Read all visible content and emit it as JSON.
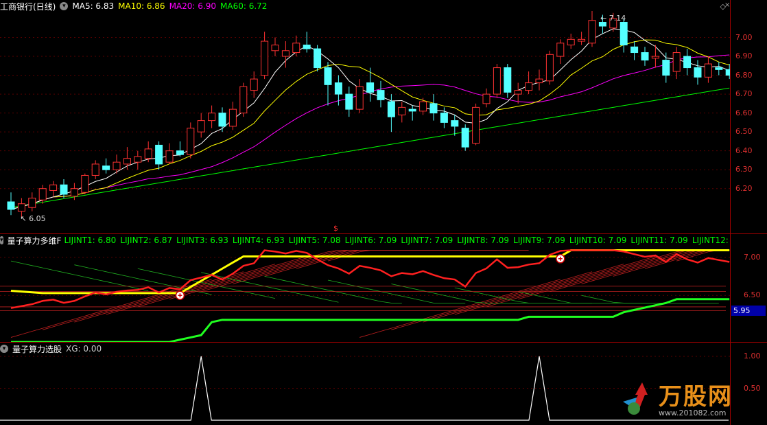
{
  "colors": {
    "ma5": "#ffffff",
    "ma10": "#ffff00",
    "ma20": "#ff00ff",
    "ma60": "#00ff00",
    "up": "#ff3232",
    "down": "#54ffff",
    "lijint": "#00ff00",
    "yellow": "#ffff00"
  },
  "main": {
    "title": "工商银行(日线)",
    "indicators": [
      {
        "label": "MA5: 6.83",
        "color": "#ffffff"
      },
      {
        "label": "MA10: 6.86",
        "color": "#ffff00"
      },
      {
        "label": "MA20: 6.90",
        "color": "#ff00ff"
      },
      {
        "label": "MA60: 6.72",
        "color": "#00ff00"
      }
    ],
    "high_annotation": "7.14",
    "low_annotation": "6.05",
    "axis": [
      "7.00",
      "6.90",
      "6.80",
      "6.70",
      "6.60",
      "6.50",
      "6.40",
      "6.30",
      "6.20"
    ]
  },
  "panel2": {
    "title": "量子算力多维F",
    "items": [
      "LIJINT1: 6.80",
      "LIJINT2: 6.87",
      "LIJINT3: 6.93",
      "LIJINT4: 6.93",
      "LIJINT5: 7.08",
      "LIJINT6: 7.09",
      "LIJINT7: 7.09",
      "LIJINT8: 7.09",
      "LIJINT9: 7.09",
      "LIJINT10: 7.09",
      "LIJINT11: 7.09",
      "LIJINT12: 7.09",
      "LIJIN"
    ],
    "axis": [
      "7.00",
      "6.50"
    ],
    "current_box": "5.95"
  },
  "panel3": {
    "title": "量子算力选股",
    "xg": "XG: 0.00",
    "axis": [
      "1.00",
      "0.50"
    ]
  },
  "watermark": {
    "brand": "万股网",
    "site": "www.201082.com"
  },
  "chart_data": [
    {
      "type": "candlestick",
      "title": "工商银行(日线)",
      "y_range": [
        6.05,
        7.14
      ],
      "candles": [
        [
          6.13,
          6.09,
          6.18,
          6.06
        ],
        [
          6.08,
          6.12,
          6.15,
          6.05
        ],
        [
          6.1,
          6.15,
          6.18,
          6.08
        ],
        [
          6.14,
          6.2,
          6.22,
          6.12
        ],
        [
          6.19,
          6.22,
          6.24,
          6.16
        ],
        [
          6.22,
          6.17,
          6.25,
          6.15
        ],
        [
          6.16,
          6.2,
          6.23,
          6.14
        ],
        [
          6.18,
          6.27,
          6.28,
          6.17
        ],
        [
          6.27,
          6.33,
          6.35,
          6.25
        ],
        [
          6.32,
          6.3,
          6.36,
          6.28
        ],
        [
          6.3,
          6.34,
          6.38,
          6.28
        ],
        [
          6.33,
          6.36,
          6.42,
          6.3
        ],
        [
          6.34,
          6.37,
          6.4,
          6.3
        ],
        [
          6.36,
          6.41,
          6.45,
          6.34
        ],
        [
          6.43,
          6.33,
          6.45,
          6.3
        ],
        [
          6.34,
          6.4,
          6.44,
          6.33
        ],
        [
          6.4,
          6.38,
          6.45,
          6.37
        ],
        [
          6.38,
          6.52,
          6.55,
          6.36
        ],
        [
          6.5,
          6.56,
          6.6,
          6.47
        ],
        [
          6.56,
          6.6,
          6.64,
          6.52
        ],
        [
          6.6,
          6.53,
          6.63,
          6.5
        ],
        [
          6.53,
          6.62,
          6.66,
          6.51
        ],
        [
          6.6,
          6.74,
          6.76,
          6.58
        ],
        [
          6.72,
          6.78,
          6.82,
          6.68
        ],
        [
          6.8,
          6.98,
          7.03,
          6.78
        ],
        [
          6.93,
          6.96,
          7.0,
          6.9
        ],
        [
          6.9,
          6.93,
          6.98,
          6.84
        ],
        [
          6.92,
          6.97,
          7.01,
          6.9
        ],
        [
          6.96,
          6.94,
          7.03,
          6.92
        ],
        [
          6.94,
          6.84,
          6.96,
          6.82
        ],
        [
          6.84,
          6.75,
          6.87,
          6.64
        ],
        [
          6.76,
          6.7,
          6.8,
          6.64
        ],
        [
          6.7,
          6.62,
          6.74,
          6.58
        ],
        [
          6.62,
          6.74,
          6.78,
          6.6
        ],
        [
          6.76,
          6.71,
          6.84,
          6.66
        ],
        [
          6.72,
          6.67,
          6.77,
          6.63
        ],
        [
          6.66,
          6.58,
          6.7,
          6.5
        ],
        [
          6.59,
          6.63,
          6.66,
          6.55
        ],
        [
          6.62,
          6.61,
          6.64,
          6.56
        ],
        [
          6.61,
          6.66,
          6.68,
          6.59
        ],
        [
          6.65,
          6.6,
          6.7,
          6.56
        ],
        [
          6.6,
          6.55,
          6.63,
          6.52
        ],
        [
          6.56,
          6.53,
          6.59,
          6.48
        ],
        [
          6.52,
          6.42,
          6.54,
          6.4
        ],
        [
          6.44,
          6.63,
          6.65,
          6.43
        ],
        [
          6.65,
          6.7,
          6.73,
          6.63
        ],
        [
          6.7,
          6.84,
          6.86,
          6.68
        ],
        [
          6.84,
          6.71,
          6.86,
          6.68
        ],
        [
          6.7,
          6.72,
          6.76,
          6.65
        ],
        [
          6.72,
          6.76,
          6.82,
          6.7
        ],
        [
          6.76,
          6.78,
          6.83,
          6.72
        ],
        [
          6.77,
          6.91,
          6.93,
          6.75
        ],
        [
          6.9,
          6.97,
          6.99,
          6.86
        ],
        [
          6.96,
          6.99,
          7.02,
          6.94
        ],
        [
          6.98,
          6.99,
          7.03,
          6.96
        ],
        [
          6.97,
          7.09,
          7.14,
          6.95
        ],
        [
          7.08,
          7.06,
          7.12,
          7.02
        ],
        [
          7.05,
          7.1,
          7.13,
          7.03
        ],
        [
          7.08,
          6.96,
          7.1,
          6.92
        ],
        [
          6.95,
          6.92,
          6.98,
          6.88
        ],
        [
          6.92,
          6.88,
          6.95,
          6.85
        ],
        [
          6.89,
          6.9,
          6.96,
          6.84
        ],
        [
          6.88,
          6.8,
          6.92,
          6.76
        ],
        [
          6.82,
          6.92,
          6.95,
          6.78
        ],
        [
          6.9,
          6.84,
          6.94,
          6.8
        ],
        [
          6.84,
          6.79,
          6.88,
          6.75
        ],
        [
          6.79,
          6.86,
          6.9,
          6.76
        ],
        [
          6.84,
          6.83,
          6.87,
          6.8
        ],
        [
          6.83,
          6.8,
          6.86,
          6.78
        ]
      ],
      "series": [
        {
          "name": "MA5",
          "last": 6.83
        },
        {
          "name": "MA10",
          "last": 6.86
        },
        {
          "name": "MA20",
          "last": 6.9
        },
        {
          "name": "MA60",
          "last": 6.72
        }
      ]
    },
    {
      "type": "line",
      "title": "量子算力多维F",
      "ylim": [
        5.9,
        7.1
      ],
      "series": [
        {
          "name": "LIJINT1",
          "last": 6.8
        },
        {
          "name": "LIJINT2",
          "last": 6.87
        },
        {
          "name": "LIJINT3",
          "last": 6.93
        },
        {
          "name": "LIJINT4",
          "last": 6.93
        },
        {
          "name": "LIJINT5",
          "last": 7.08
        },
        {
          "name": "LIJINT6",
          "last": 7.09
        },
        {
          "name": "LIJINT7",
          "last": 7.09
        },
        {
          "name": "LIJINT8",
          "last": 7.09
        },
        {
          "name": "LIJINT9",
          "last": 7.09
        },
        {
          "name": "LIJINT10",
          "last": 7.09
        },
        {
          "name": "LIJINT11",
          "last": 7.09
        },
        {
          "name": "LIJINT12",
          "last": 7.09
        }
      ]
    },
    {
      "type": "line",
      "title": "量子算力选股",
      "ylim": [
        0,
        1
      ],
      "series": [
        {
          "name": "XG",
          "last": 0.0,
          "spikes_at_candle": [
            18,
            50
          ]
        }
      ]
    }
  ]
}
